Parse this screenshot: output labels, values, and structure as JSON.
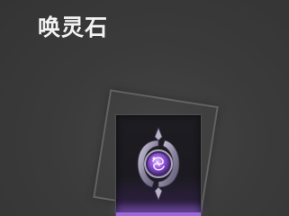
{
  "title": "唤灵石",
  "item": {
    "icon": "summon-stone-icon",
    "rarity_color": "#9a68d8"
  }
}
